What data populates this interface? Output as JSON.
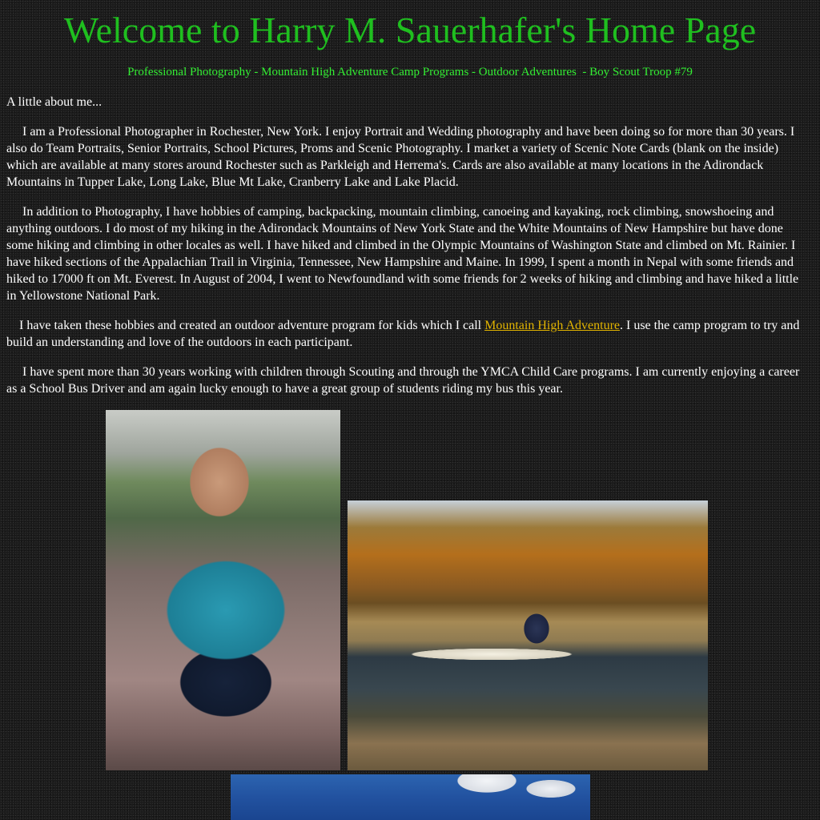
{
  "page": {
    "title": "Welcome to Harry M. Sauerhafer's Home Page"
  },
  "nav": {
    "items": [
      "Professional Photography",
      "Mountain High Adventure Camp Programs",
      "Outdoor Adventures",
      "Boy Scout Troop #79"
    ],
    "separator": " - "
  },
  "content": {
    "intro": "A little about me...",
    "p1": "I am a Professional Photographer in Rochester, New York. I enjoy Portrait and Wedding photography and have been doing so for more than 30 years. I also do Team Portraits, Senior Portraits, School Pictures, Proms and Scenic Photography. I  market a variety of Scenic Note Cards (blank on the inside) which are available at many stores around Rochester such as Parkleigh and Herrema's. Cards are also available at many locations in the Adirondack Mountains in Tupper Lake, Long Lake, Blue Mt Lake, Cranberry Lake and Lake Placid.",
    "p2": "In addition to Photography, I have hobbies of camping, backpacking, mountain climbing, canoeing and kayaking, rock climbing, snowshoeing and anything outdoors. I do most of my hiking in the Adirondack Mountains of New York State and the White Mountains of New Hampshire but have done some hiking and climbing in other locales as well. I have hiked and climbed in the Olympic Mountains of Washington State and climbed on Mt. Rainier. I have hiked sections of the Appalachian Trail in Virginia, Tennessee, New Hampshire and Maine. In 1999, I spent a month in Nepal with some friends and hiked to 17000 ft on Mt. Everest. In August of 2004, I went to Newfoundland with some friends for 2 weeks of hiking and climbing and have hiked a little in Yellowstone National Park.",
    "p3_before": "I have taken these hobbies and created an outdoor adventure program for kids which I call ",
    "p3_link": "Mountain High Adventure",
    "p3_after": ". I use the camp program to try and build an understanding and love of the outdoors in each participant.",
    "p4": "I have spent more than 30 years working with children through Scouting and through the YMCA Child Care programs. I am currently enjoying a career as a School Bus Driver and am again lucky enough to have a great group of students riding my bus this year."
  },
  "colors": {
    "title": "#1fbf1f",
    "nav": "#33ee33",
    "link": "#e2b400",
    "text": "#ffffff",
    "background": "#1b1b1b"
  }
}
